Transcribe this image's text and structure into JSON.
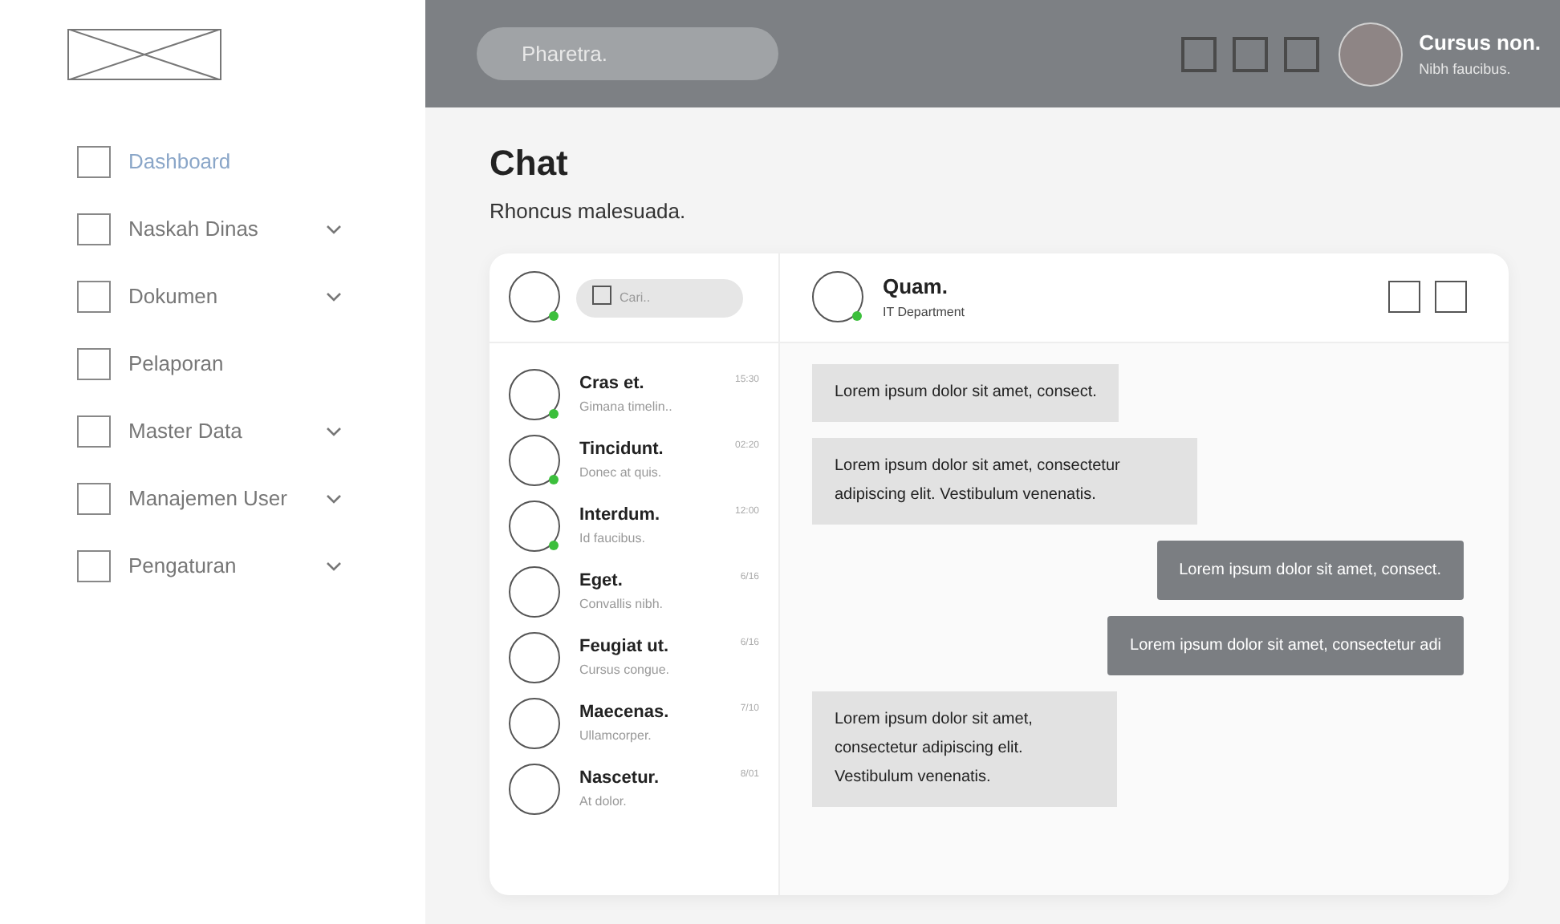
{
  "header": {
    "search": {
      "placeholder": "Pharetra."
    },
    "user": {
      "name": "Cursus non.",
      "subtitle": "Nibh faucibus."
    }
  },
  "sidebar": {
    "items": [
      {
        "label": "Dashboard",
        "selected": true,
        "expandable": false
      },
      {
        "label": "Naskah Dinas",
        "selected": false,
        "expandable": true
      },
      {
        "label": "Dokumen",
        "selected": false,
        "expandable": true
      },
      {
        "label": "Pelaporan",
        "selected": false,
        "expandable": false
      },
      {
        "label": "Master Data",
        "selected": false,
        "expandable": true
      },
      {
        "label": "Manajemen User",
        "selected": false,
        "expandable": true
      },
      {
        "label": "Pengaturan",
        "selected": false,
        "expandable": true
      }
    ]
  },
  "page": {
    "title": "Chat",
    "subtitle": "Rhoncus malesuada."
  },
  "contacts": {
    "self_online": true,
    "search": {
      "placeholder": "Cari.."
    },
    "items": [
      {
        "name": "Cras et.",
        "preview": "Gimana timelin..",
        "time": "15:30",
        "online": true
      },
      {
        "name": "Tincidunt.",
        "preview": "Donec at quis.",
        "time": "02:20",
        "online": true
      },
      {
        "name": "Interdum.",
        "preview": "Id faucibus.",
        "time": "12:00",
        "online": true
      },
      {
        "name": "Eget.",
        "preview": "Convallis nibh.",
        "time": "6/16",
        "online": false
      },
      {
        "name": "Feugiat ut.",
        "preview": "Cursus congue.",
        "time": "6/16",
        "online": false
      },
      {
        "name": "Maecenas.",
        "preview": "Ullamcorper.",
        "time": "7/10",
        "online": false
      },
      {
        "name": "Nascetur.",
        "preview": "At dolor.",
        "time": "8/01",
        "online": false
      }
    ]
  },
  "conversation": {
    "name": "Quam.",
    "department": "IT Department",
    "online": true,
    "messages": [
      {
        "kind": "received",
        "text": "Lorem ipsum dolor sit amet, consect."
      },
      {
        "kind": "received",
        "text": "Lorem ipsum dolor sit amet, consectetur adipiscing elit. Vestibulum venenatis."
      },
      {
        "kind": "sent",
        "text": "Lorem ipsum dolor sit amet, consect."
      },
      {
        "kind": "sent",
        "text": "Lorem ipsum dolor sit amet, consectetur adi"
      },
      {
        "kind": "received",
        "text": "Lorem ipsum dolor sit amet, consectetur adipiscing elit. Vestibulum venenatis."
      }
    ]
  }
}
